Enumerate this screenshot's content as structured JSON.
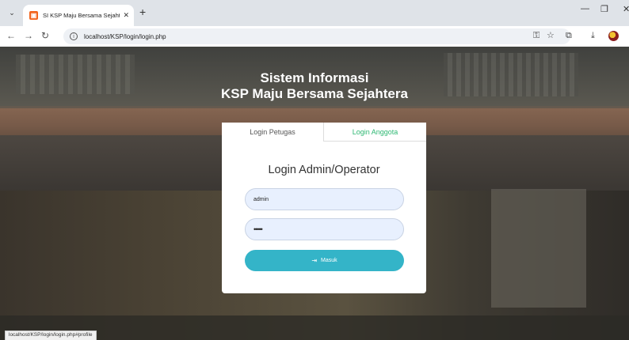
{
  "browser": {
    "tab_title": "SI KSP Maju Bersama Sejahtera",
    "url": "localhost/KSP/login/login.php",
    "status_url": "localhost/KSP/login/login.php#profile"
  },
  "page": {
    "title_line1": "Sistem Informasi",
    "title_line2": "KSP Maju Bersama Sejahtera"
  },
  "login": {
    "tabs": [
      {
        "label": "Login Petugas",
        "active": true
      },
      {
        "label": "Login Anggota",
        "active": false
      }
    ],
    "form_title": "Login Admin/Operator",
    "username_value": "admin",
    "password_value": "•••••",
    "submit_label": "Masuk"
  },
  "colors": {
    "accent_button": "#34b4c8",
    "inactive_tab_text": "#2eb873",
    "input_bg": "#e8f0fe"
  }
}
